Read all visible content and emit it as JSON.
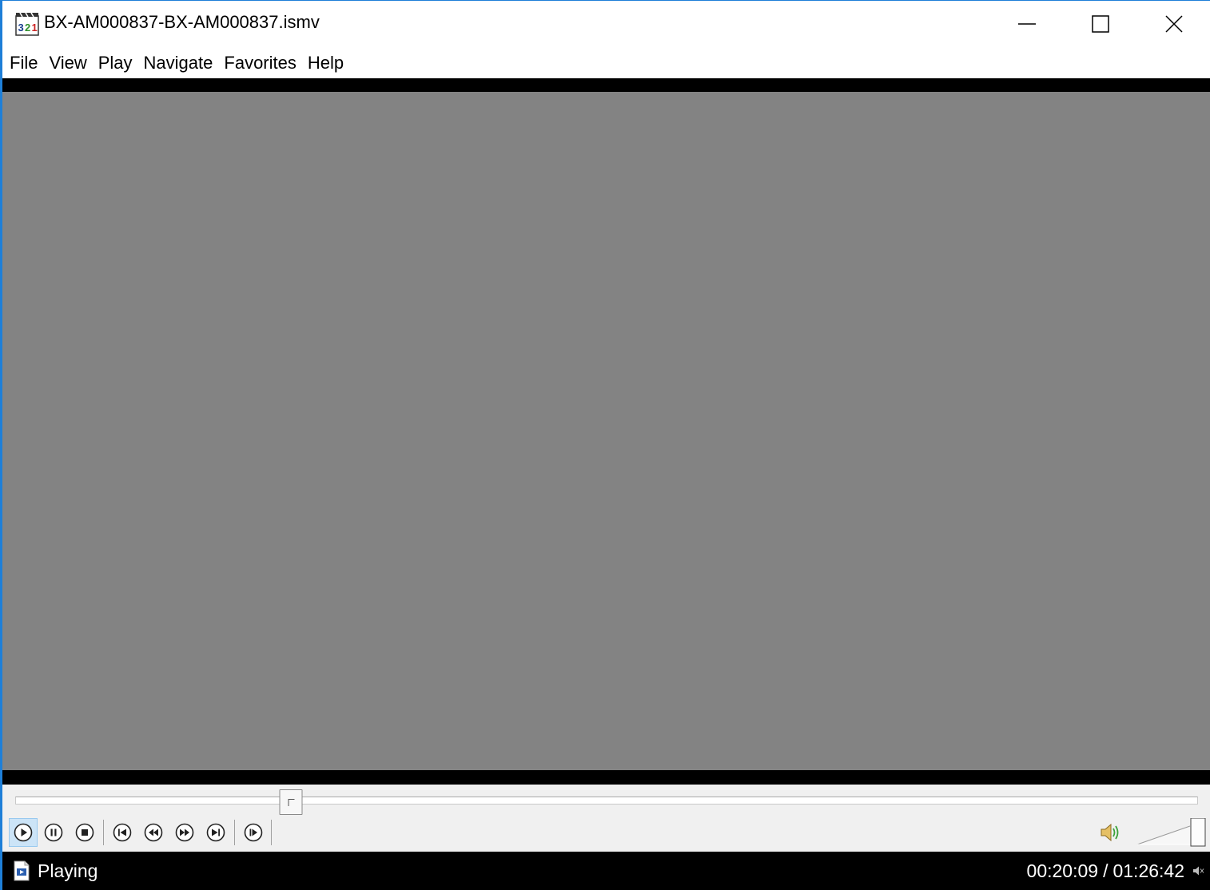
{
  "window": {
    "title": "BX-AM000837-BX-AM000837.ismv",
    "minimize_icon": "minimize-icon",
    "maximize_icon": "maximize-icon",
    "close_icon": "close-icon"
  },
  "menu": {
    "items": [
      {
        "label": "File"
      },
      {
        "label": "View"
      },
      {
        "label": "Play"
      },
      {
        "label": "Navigate"
      },
      {
        "label": "Favorites"
      },
      {
        "label": "Help"
      }
    ]
  },
  "seek": {
    "progress": 0.2325
  },
  "controls": {
    "buttons": [
      {
        "icon": "play-icon",
        "active": true
      },
      {
        "icon": "pause-icon",
        "active": false
      },
      {
        "icon": "stop-icon",
        "active": false
      },
      {
        "icon": "previous-icon",
        "active": false
      },
      {
        "icon": "rewind-icon",
        "active": false
      },
      {
        "icon": "fast-forward-icon",
        "active": false
      },
      {
        "icon": "next-icon",
        "active": false
      },
      {
        "icon": "frame-step-icon",
        "active": false
      }
    ],
    "volume_icon": "speaker-icon",
    "volume_level": 1.0
  },
  "status": {
    "state": "Playing",
    "current_time": "00:20:09",
    "separator": "/",
    "total_time": "01:26:42"
  },
  "colors": {
    "accent": "#1e7fd8",
    "video_background": "#838383",
    "controls_background": "#f0f0f0",
    "status_background": "#000000",
    "active_button": "#cce4f7"
  }
}
